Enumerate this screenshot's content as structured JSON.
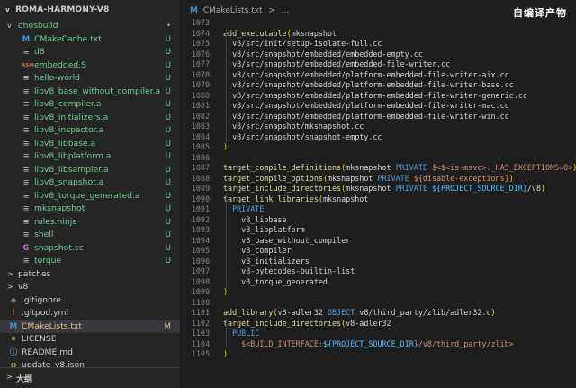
{
  "explorer": {
    "title": "ROMA-HARMONY-V8",
    "items": [
      {
        "label": "ohosbuild",
        "icon": "folder",
        "status": "•",
        "git": true,
        "depth": 1,
        "chev": "v"
      },
      {
        "label": "CMakeCache.txt",
        "icon": "M",
        "status": "U",
        "git": true,
        "depth": 2
      },
      {
        "label": "d8",
        "icon": "≡",
        "status": "U",
        "git": true,
        "depth": 2
      },
      {
        "label": "embedded.S",
        "icon": "ASM",
        "status": "U",
        "git": true,
        "depth": 2
      },
      {
        "label": "hello-world",
        "icon": "≡",
        "status": "U",
        "git": true,
        "depth": 2
      },
      {
        "label": "libv8_base_without_compiler.a",
        "icon": "≡",
        "status": "U",
        "git": true,
        "depth": 2
      },
      {
        "label": "libv8_compiler.a",
        "icon": "≡",
        "status": "U",
        "git": true,
        "depth": 2
      },
      {
        "label": "libv8_initializers.a",
        "icon": "≡",
        "status": "U",
        "git": true,
        "depth": 2
      },
      {
        "label": "libv8_inspector.a",
        "icon": "≡",
        "status": "U",
        "git": true,
        "depth": 2
      },
      {
        "label": "libv8_libbase.a",
        "icon": "≡",
        "status": "U",
        "git": true,
        "depth": 2
      },
      {
        "label": "libv8_libplatform.a",
        "icon": "≡",
        "status": "U",
        "git": true,
        "depth": 2
      },
      {
        "label": "libv8_libsampler.a",
        "icon": "≡",
        "status": "U",
        "git": true,
        "depth": 2
      },
      {
        "label": "libv8_snapshot.a",
        "icon": "≡",
        "status": "U",
        "git": true,
        "depth": 2
      },
      {
        "label": "libv8_torque_generated.a",
        "icon": "≡",
        "status": "U",
        "git": true,
        "depth": 2
      },
      {
        "label": "mksnapshot",
        "icon": "≡",
        "status": "U",
        "git": true,
        "depth": 2
      },
      {
        "label": "rules.ninja",
        "icon": "≡",
        "status": "U",
        "git": true,
        "depth": 2
      },
      {
        "label": "shell",
        "icon": "≡",
        "status": "U",
        "git": true,
        "depth": 2
      },
      {
        "label": "snapshot.cc",
        "icon": "G",
        "status": "U",
        "git": true,
        "depth": 2
      },
      {
        "label": "torque",
        "icon": "≡",
        "status": "U",
        "git": true,
        "depth": 2
      },
      {
        "label": "patches",
        "icon": "",
        "status": "",
        "git": false,
        "depth": 1,
        "chev": ">"
      },
      {
        "label": "v8",
        "icon": "",
        "status": "",
        "git": false,
        "depth": 1,
        "chev": ">"
      },
      {
        "label": ".gitignore",
        "icon": "◆",
        "status": "",
        "git": false,
        "depth": 1
      },
      {
        "label": ".gitpod.yml",
        "icon": "!",
        "status": "",
        "git": false,
        "depth": 1
      },
      {
        "label": "CMakeLists.txt",
        "icon": "M",
        "status": "M",
        "git": false,
        "depth": 1,
        "sel": true,
        "modified": true
      },
      {
        "label": "LICENSE",
        "icon": "𝕽",
        "status": "",
        "git": false,
        "depth": 1
      },
      {
        "label": "README.md",
        "icon": "ⓘ",
        "status": "",
        "git": false,
        "depth": 1
      },
      {
        "label": "update_v8.json",
        "icon": "{}",
        "status": "",
        "git": false,
        "depth": 1
      }
    ],
    "outline_label": "大纲"
  },
  "breadcrumb": {
    "file": "CMakeLists.txt",
    "sep": ">",
    "rest": "..."
  },
  "watermark": "自编译产物",
  "code": {
    "lines": [
      {
        "n": "1073",
        "t": [
          [
            "",
            ""
          ]
        ]
      },
      {
        "n": "1074",
        "t": [
          [
            "fn",
            "add_executable"
          ],
          [
            "par",
            "("
          ],
          [
            "",
            "mksnapshot"
          ]
        ]
      },
      {
        "n": "1075",
        "t": [
          [
            "",
            "  v8/src/init/setup-isolate-full.cc"
          ]
        ]
      },
      {
        "n": "1076",
        "t": [
          [
            "",
            "  v8/src/snapshot/embedded/embedded-empty.cc"
          ]
        ]
      },
      {
        "n": "1077",
        "t": [
          [
            "",
            "  v8/src/snapshot/embedded/embedded-file-writer.cc"
          ]
        ]
      },
      {
        "n": "1078",
        "t": [
          [
            "",
            "  v8/src/snapshot/embedded/platform-embedded-file-writer-aix.cc"
          ]
        ]
      },
      {
        "n": "1079",
        "t": [
          [
            "",
            "  v8/src/snapshot/embedded/platform-embedded-file-writer-base.cc"
          ]
        ]
      },
      {
        "n": "1080",
        "t": [
          [
            "",
            "  v8/src/snapshot/embedded/platform-embedded-file-writer-generic.cc"
          ]
        ]
      },
      {
        "n": "1081",
        "t": [
          [
            "",
            "  v8/src/snapshot/embedded/platform-embedded-file-writer-mac.cc"
          ]
        ]
      },
      {
        "n": "1082",
        "t": [
          [
            "",
            "  v8/src/snapshot/embedded/platform-embedded-file-writer-win.cc"
          ]
        ]
      },
      {
        "n": "1083",
        "t": [
          [
            "",
            "  v8/src/snapshot/mksnapshot.cc"
          ]
        ]
      },
      {
        "n": "1084",
        "t": [
          [
            "",
            "  v8/src/snapshot/snapshot-empty.cc"
          ]
        ]
      },
      {
        "n": "1085",
        "t": [
          [
            "par",
            ")"
          ]
        ]
      },
      {
        "n": "1086",
        "t": [
          [
            "",
            ""
          ]
        ]
      },
      {
        "n": "1087",
        "t": [
          [
            "fn",
            "target_compile_definitions"
          ],
          [
            "par",
            "("
          ],
          [
            "",
            "mksnapshot "
          ],
          [
            "kw",
            "PRIVATE"
          ],
          [
            "",
            ""
          ],
          [
            "str",
            " $<$<is-msvc>:_HAS_EXCEPTIONS=0>"
          ],
          [
            "par",
            ")"
          ]
        ]
      },
      {
        "n": "1088",
        "t": [
          [
            "fn",
            "target_compile_options"
          ],
          [
            "par",
            "("
          ],
          [
            "",
            "mksnapshot "
          ],
          [
            "kw",
            "PRIVATE"
          ],
          [
            "",
            ""
          ],
          [
            "str",
            " ${disable-exceptions}"
          ],
          [
            "par",
            ")"
          ]
        ]
      },
      {
        "n": "1089",
        "t": [
          [
            "fn",
            "target_include_directories"
          ],
          [
            "par",
            "("
          ],
          [
            "",
            "mksnapshot "
          ],
          [
            "kw",
            "PRIVATE"
          ],
          [
            "",
            ""
          ],
          [
            "var",
            " ${PROJECT_SOURCE_DIR}"
          ],
          [
            "",
            "/v8"
          ],
          [
            "par",
            ")"
          ]
        ]
      },
      {
        "n": "1090",
        "t": [
          [
            "fn",
            "target_link_libraries"
          ],
          [
            "par",
            "("
          ],
          [
            "",
            "mksnapshot"
          ]
        ]
      },
      {
        "n": "1091",
        "t": [
          [
            "kw",
            "  PRIVATE"
          ]
        ]
      },
      {
        "n": "1092",
        "t": [
          [
            "",
            "    v8_libbase"
          ]
        ]
      },
      {
        "n": "1093",
        "t": [
          [
            "",
            "    v8_libplatform"
          ]
        ]
      },
      {
        "n": "1094",
        "t": [
          [
            "",
            "    v8_base_without_compiler"
          ]
        ]
      },
      {
        "n": "1095",
        "t": [
          [
            "",
            "    v8_compiler"
          ]
        ]
      },
      {
        "n": "1096",
        "t": [
          [
            "",
            "    v8_initializers"
          ]
        ]
      },
      {
        "n": "1097",
        "t": [
          [
            "",
            "    v8-bytecodes-builtin-list"
          ]
        ]
      },
      {
        "n": "1098",
        "t": [
          [
            "",
            "    v8_torque_generated"
          ]
        ]
      },
      {
        "n": "1099",
        "t": [
          [
            "par",
            ")"
          ]
        ]
      },
      {
        "n": "1100",
        "t": [
          [
            "",
            ""
          ]
        ]
      },
      {
        "n": "1101",
        "t": [
          [
            "fn",
            "add_library"
          ],
          [
            "par",
            "("
          ],
          [
            "",
            "v8-adler32 "
          ],
          [
            "kw",
            "OBJECT"
          ],
          [
            "",
            ""
          ],
          [
            "",
            " v8/third_party/zlib/adler32.c"
          ],
          [
            "par",
            ")"
          ]
        ]
      },
      {
        "n": "1102",
        "t": [
          [
            "fn",
            "target_include_directories"
          ],
          [
            "par",
            "("
          ],
          [
            "",
            "v8-adler32"
          ]
        ]
      },
      {
        "n": "1103",
        "t": [
          [
            "kw",
            "  PUBLIC"
          ]
        ]
      },
      {
        "n": "1104",
        "t": [
          [
            "str",
            "    $<BUILD_INTERFACE:"
          ],
          [
            "var",
            "${PROJECT_SOURCE_DIR}"
          ],
          [
            "str",
            "/v8/third_party/zlib>"
          ]
        ]
      },
      {
        "n": "1105",
        "t": [
          [
            "par",
            ")"
          ]
        ]
      }
    ]
  }
}
